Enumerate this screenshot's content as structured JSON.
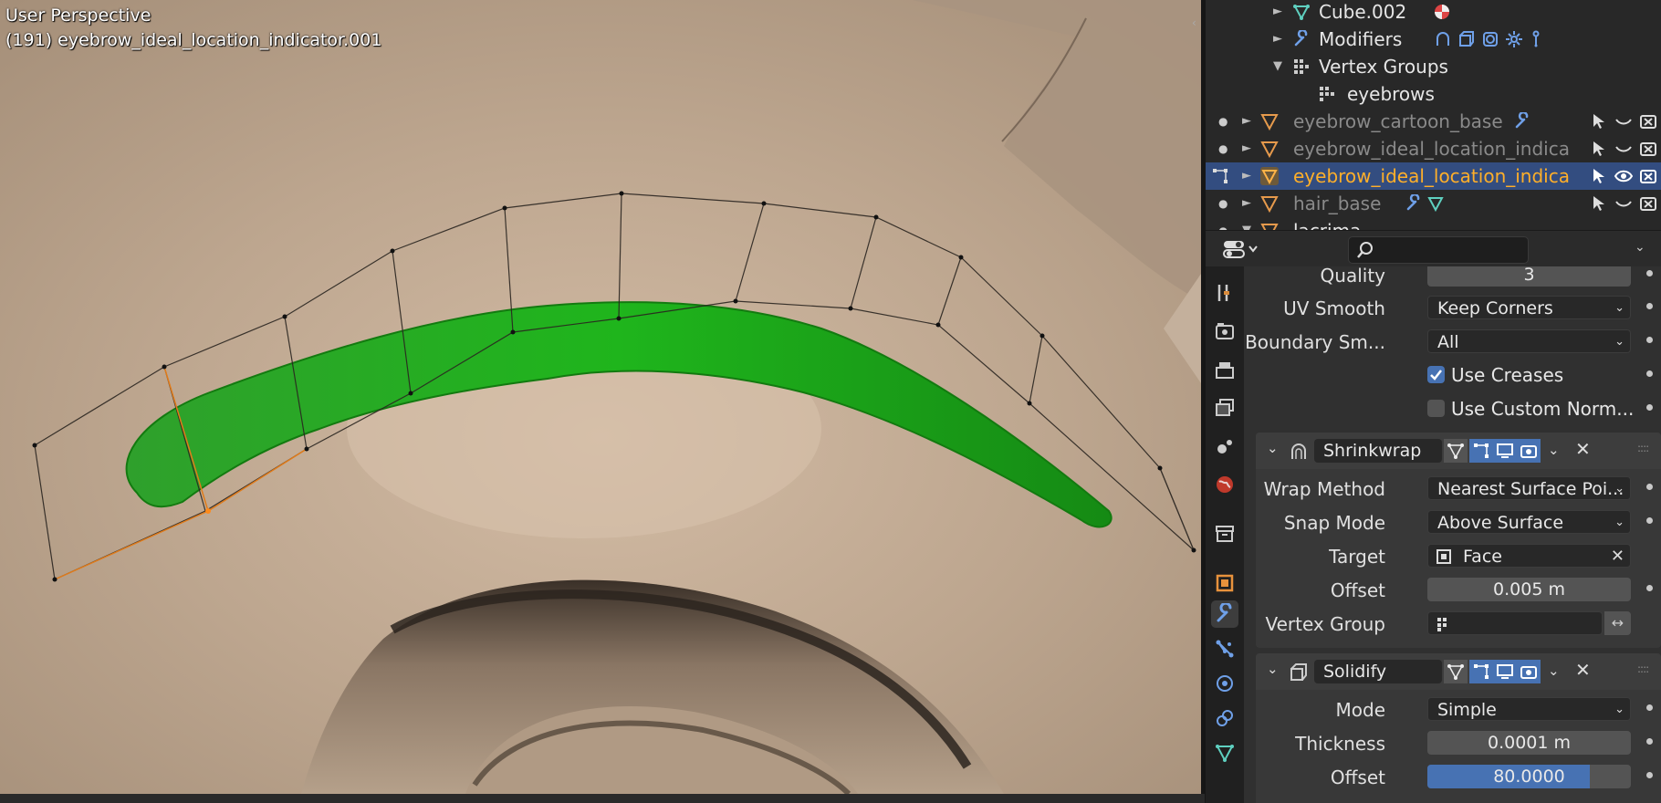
{
  "viewport": {
    "title": "User Perspective",
    "object_line": "(191) eyebrow_ideal_location_indicator.001"
  },
  "outliner": {
    "rows": [
      {
        "label": "Cube.002",
        "icon": "mesh-data-icon"
      },
      {
        "label": "Modifiers",
        "icon": "wrench-icon"
      },
      {
        "label": "Vertex Groups",
        "icon": "vertex-groups-icon"
      },
      {
        "label": "eyebrows",
        "icon": "vertex-group-icon"
      },
      {
        "label": "eyebrow_cartoon_base",
        "icon": "mesh-object-icon"
      },
      {
        "label": "eyebrow_ideal_location_indica",
        "icon": "mesh-object-icon"
      },
      {
        "label": "eyebrow_ideal_location_indica",
        "icon": "mesh-object-icon",
        "selected": true
      },
      {
        "label": "hair_base",
        "icon": "mesh-object-icon"
      },
      {
        "label": "lacrima",
        "icon": "mesh-object-icon"
      }
    ]
  },
  "properties": {
    "search_placeholder": "",
    "subdivision": {
      "quality_label": "Quality",
      "quality_value": "3",
      "uv_smooth_label": "UV Smooth",
      "uv_smooth_value": "Keep Corners",
      "boundary_label": "Boundary Sm...",
      "boundary_value": "All",
      "use_creases_label": "Use Creases",
      "use_creases": true,
      "use_custom_normals_label": "Use Custom Norm...",
      "use_custom_normals": false
    },
    "shrinkwrap": {
      "name": "Shrinkwrap",
      "wrap_method_label": "Wrap Method",
      "wrap_method_value": "Nearest Surface Poi...",
      "snap_mode_label": "Snap Mode",
      "snap_mode_value": "Above Surface",
      "target_label": "Target",
      "target_value": "Face",
      "offset_label": "Offset",
      "offset_value": "0.005 m",
      "vertex_group_label": "Vertex Group",
      "vertex_group_value": ""
    },
    "solidify": {
      "name": "Solidify",
      "mode_label": "Mode",
      "mode_value": "Simple",
      "thickness_label": "Thickness",
      "thickness_value": "0.0001 m",
      "offset_label": "Offset",
      "offset_value": "80.0000",
      "offset_fill_fraction": 0.8
    }
  },
  "colors": {
    "accent_blue": "#4772b3",
    "selected_row": "#334d80",
    "active_object_text": "#ffaf29",
    "eyebrow_green": "#22b020",
    "skin": "#b39e88"
  }
}
